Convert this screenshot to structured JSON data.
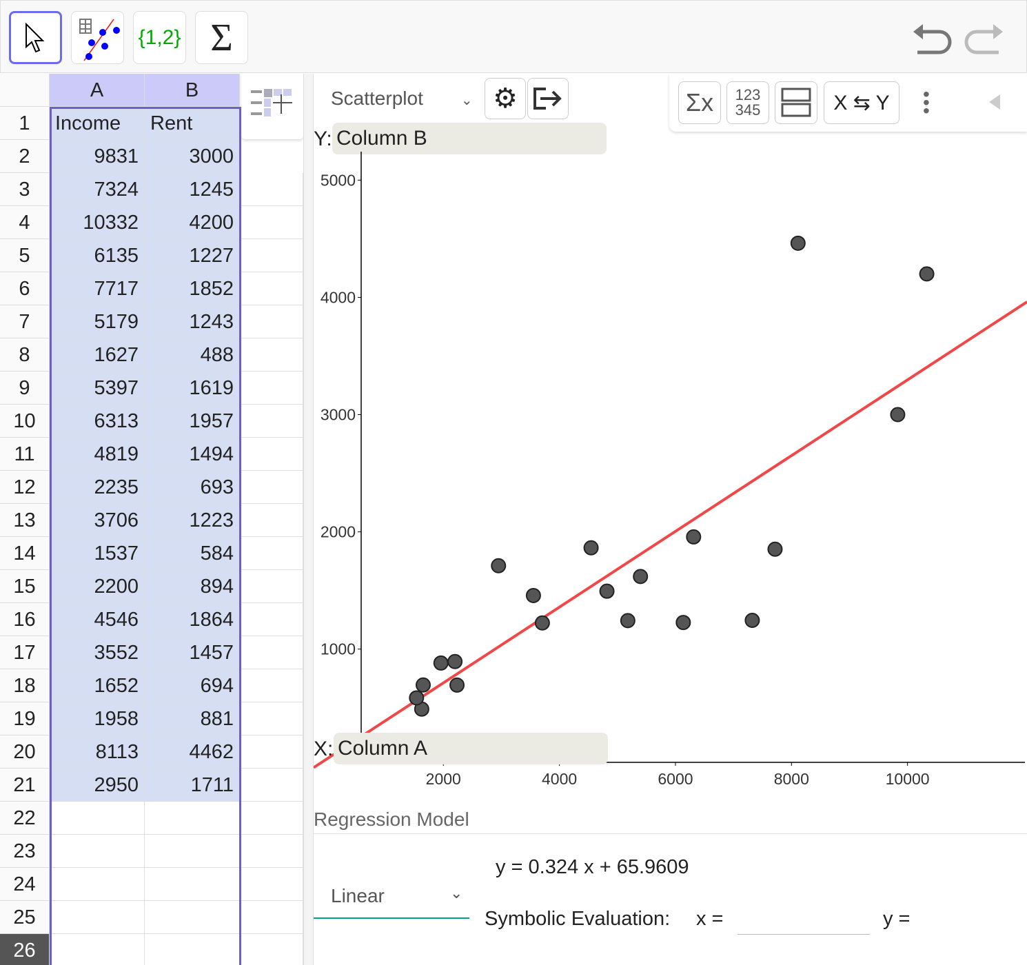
{
  "toolbar": {
    "tools": [
      {
        "name": "move-tool",
        "icon": "arrow-cursor-icon"
      },
      {
        "name": "two-variable-regression-tool",
        "icon": "scatter-regression-icon"
      },
      {
        "name": "create-list-tool",
        "label": "{1,2}"
      },
      {
        "name": "sum-tool",
        "label": "Σ"
      }
    ],
    "undo_icon": "undo-icon",
    "redo_icon": "redo-icon"
  },
  "spreadsheet": {
    "columns": [
      "A",
      "B"
    ],
    "header_row": [
      "Income",
      "Rent"
    ],
    "rows": [
      [
        "9831",
        "3000"
      ],
      [
        "7324",
        "1245"
      ],
      [
        "10332",
        "4200"
      ],
      [
        "6135",
        "1227"
      ],
      [
        "7717",
        "1852"
      ],
      [
        "5179",
        "1243"
      ],
      [
        "1627",
        "488"
      ],
      [
        "5397",
        "1619"
      ],
      [
        "6313",
        "1957"
      ],
      [
        "4819",
        "1494"
      ],
      [
        "2235",
        "693"
      ],
      [
        "3706",
        "1223"
      ],
      [
        "1537",
        "584"
      ],
      [
        "2200",
        "894"
      ],
      [
        "4546",
        "1864"
      ],
      [
        "3552",
        "1457"
      ],
      [
        "1652",
        "694"
      ],
      [
        "1958",
        "881"
      ],
      [
        "8113",
        "4462"
      ],
      [
        "2950",
        "1711"
      ]
    ],
    "row_numbers": [
      "1",
      "2",
      "3",
      "4",
      "5",
      "6",
      "7",
      "8",
      "9",
      "10",
      "11",
      "12",
      "13",
      "14",
      "15",
      "16",
      "17",
      "18",
      "19",
      "20",
      "21",
      "22",
      "23",
      "24",
      "25",
      "26"
    ]
  },
  "analysis": {
    "plot_type": "Scatterplot",
    "y_label": "Y:",
    "y_source": "Column B",
    "x_label": "X:",
    "x_source": "Column A",
    "swap_label": "X ⇆ Y",
    "sigma_label": "Σx",
    "numbers_label_1": "123",
    "numbers_label_2": "345",
    "regression_title": "Regression Model",
    "regression_type": "Linear",
    "equation": "y = 0.324 x + 65.9609",
    "symbolic_label": "Symbolic Evaluation:",
    "x_eq": "x =",
    "y_eq": "y =",
    "x_value": ""
  },
  "chart_data": {
    "type": "scatter",
    "x_ticks": [
      "2000",
      "4000",
      "6000",
      "8000",
      "10000"
    ],
    "y_ticks": [
      "1000",
      "2000",
      "3000",
      "4000",
      "5000"
    ],
    "xlim": [
      583,
      12024
    ],
    "ylim": [
      34,
      5243
    ],
    "points": [
      [
        9831,
        3000
      ],
      [
        7324,
        1245
      ],
      [
        10332,
        4200
      ],
      [
        6135,
        1227
      ],
      [
        7717,
        1852
      ],
      [
        5179,
        1243
      ],
      [
        1627,
        488
      ],
      [
        5397,
        1619
      ],
      [
        6313,
        1957
      ],
      [
        4819,
        1494
      ],
      [
        2235,
        693
      ],
      [
        3706,
        1223
      ],
      [
        1537,
        584
      ],
      [
        2200,
        894
      ],
      [
        4546,
        1864
      ],
      [
        3552,
        1457
      ],
      [
        1652,
        694
      ],
      [
        1958,
        881
      ],
      [
        8113,
        4462
      ],
      [
        2950,
        1711
      ]
    ],
    "regression": {
      "slope": 0.324,
      "intercept": 65.9609,
      "color": "#f04848"
    },
    "point_color": "#555555"
  }
}
